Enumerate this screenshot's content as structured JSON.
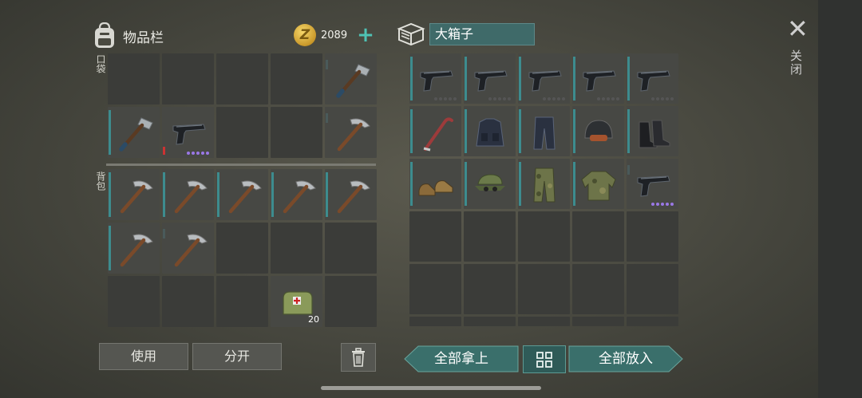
{
  "inventory": {
    "title": "物品栏",
    "coins": "2089",
    "coin_symbol": "Z",
    "add_symbol": "+",
    "pocket_label": "口袋",
    "backpack_label": "背包",
    "pocket_slots": [
      {
        "item": null
      },
      {
        "item": null
      },
      {
        "item": null
      },
      {
        "item": null
      },
      {
        "item": "hammer",
        "bar": "mid"
      },
      {
        "item": "hammer",
        "bar": "full"
      },
      {
        "item": "pistol",
        "bar": "short",
        "dots": "purple"
      },
      {
        "item": null
      },
      {
        "item": null
      },
      {
        "item": "pickaxe",
        "bar": "mid"
      }
    ],
    "backpack_slots": [
      {
        "item": "pickaxe",
        "bar": "full"
      },
      {
        "item": "pickaxe",
        "bar": "full"
      },
      {
        "item": "pickaxe",
        "bar": "full"
      },
      {
        "item": "pickaxe",
        "bar": "full"
      },
      {
        "item": "pickaxe",
        "bar": "full"
      },
      {
        "item": "pickaxe",
        "bar": "full"
      },
      {
        "item": "pickaxe",
        "bar": "mid"
      },
      {
        "item": null
      },
      {
        "item": null
      },
      {
        "item": null
      },
      {
        "item": null
      },
      {
        "item": null
      },
      {
        "item": null
      },
      {
        "item": "medkit-bag",
        "qty": "20"
      },
      {
        "item": null
      }
    ]
  },
  "container": {
    "name": "大箱子",
    "slots": [
      {
        "item": "pistol",
        "bar": "full",
        "dots": "grey"
      },
      {
        "item": "pistol",
        "bar": "full",
        "dots": "grey"
      },
      {
        "item": "pistol",
        "bar": "full",
        "dots": "grey"
      },
      {
        "item": "pistol",
        "bar": "full",
        "dots": "grey"
      },
      {
        "item": "pistol",
        "bar": "full",
        "dots": "grey"
      },
      {
        "item": "crowbar",
        "bar": "full"
      },
      {
        "item": "tactical-vest",
        "bar": "full"
      },
      {
        "item": "tactical-pants",
        "bar": "full"
      },
      {
        "item": "helmet",
        "bar": "full"
      },
      {
        "item": "boots",
        "bar": "full"
      },
      {
        "item": "shoes",
        "bar": "full"
      },
      {
        "item": "cap",
        "bar": "full"
      },
      {
        "item": "camo-pants",
        "bar": "full"
      },
      {
        "item": "camo-jacket",
        "bar": "full"
      },
      {
        "item": "pistol",
        "bar": "mid",
        "dots": "purple"
      },
      {
        "item": null
      },
      {
        "item": null
      },
      {
        "item": null
      },
      {
        "item": null
      },
      {
        "item": null
      },
      {
        "item": null
      },
      {
        "item": null
      },
      {
        "item": null
      },
      {
        "item": null
      },
      {
        "item": null
      },
      {
        "item": null
      },
      {
        "item": null
      },
      {
        "item": null
      },
      {
        "item": null
      },
      {
        "item": null
      }
    ]
  },
  "buttons": {
    "use": "使用",
    "split": "分开",
    "take_all": "全部拿上",
    "put_all": "全部放入",
    "close_label": "关闭",
    "close_symbol": "✕"
  },
  "colors": {
    "accent": "#3d8c8e",
    "button_teal": "#3a6f6b"
  }
}
